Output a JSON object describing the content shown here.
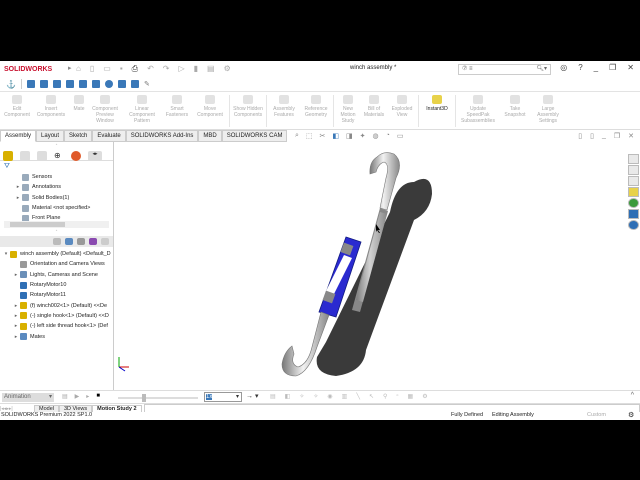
{
  "app": {
    "logo": "SOLIDWORKS",
    "title": "winch assembly *",
    "search_placeholder": "",
    "search_prefix": "⑦ ≡"
  },
  "command_manager": [
    {
      "label": "Edit Component",
      "active": false
    },
    {
      "label": "Insert Components",
      "active": false
    },
    {
      "label": "Mate",
      "active": false
    },
    {
      "label": "Component Preview Window",
      "active": false
    },
    {
      "label": "Linear Component Pattern",
      "active": false
    },
    {
      "label": "Smart Fasteners",
      "active": false
    },
    {
      "label": "Move Component",
      "active": false
    },
    {
      "label": "Show Hidden Components",
      "active": false
    },
    {
      "label": "Assembly Features",
      "active": false
    },
    {
      "label": "Reference Geometry",
      "active": false
    },
    {
      "label": "New Motion Study",
      "active": false
    },
    {
      "label": "Bill of Materials",
      "active": false
    },
    {
      "label": "Exploded View",
      "active": false
    },
    {
      "label": "Instant3D",
      "active": true
    },
    {
      "label": "Update SpeedPak Subassemblies",
      "active": false
    },
    {
      "label": "Take Snapshot",
      "active": false
    },
    {
      "label": "Large Assembly Settings",
      "active": false
    }
  ],
  "tabs": [
    "Assembly",
    "Layout",
    "Sketch",
    "Evaluate",
    "SOLIDWORKS Add-Ins",
    "MBD",
    "SOLIDWORKS CAM"
  ],
  "feature_tree_top": [
    "Sensors",
    "Annotations",
    "Solid Bodies(1)",
    "Material <not specified>",
    "Front Plane"
  ],
  "feature_tree": [
    {
      "label": "winch assembly (Default) <Default_D",
      "arrow": "▾",
      "color": "#d8b000"
    },
    {
      "label": "Orientation and Camera Views",
      "arrow": "",
      "color": "#999"
    },
    {
      "label": "Lights, Cameras and Scene",
      "arrow": "▸",
      "color": "#6a8fb8"
    },
    {
      "label": "RotaryMotor10",
      "arrow": "",
      "color": "#2f6fb5"
    },
    {
      "label": "RotaryMotor11",
      "arrow": "",
      "color": "#2f6fb5"
    },
    {
      "label": "(f) winch002<1> (Default) <<De",
      "arrow": "▸",
      "color": "#d8b000"
    },
    {
      "label": "(-) single hook<1> (Default) <<D",
      "arrow": "▸",
      "color": "#d8b000"
    },
    {
      "label": "(-) left side thread hook<1> (Def",
      "arrow": "▸",
      "color": "#d8b000"
    },
    {
      "label": "Mates",
      "arrow": "▸",
      "color": "#5a8ac0"
    }
  ],
  "motion": {
    "study_type": "Animation",
    "speed": "1x",
    "tabs": [
      "Model",
      "3D Views",
      "Motion Study 2"
    ],
    "active_tab": "Motion Study 2"
  },
  "status": {
    "product": "SOLIDWORKS Premium 2022 SP1.0",
    "state": "Fully Defined",
    "mode": "Editing Assembly",
    "units": "Custom"
  },
  "colors": {
    "accent": "#c8102e",
    "model_blue": "#2a2ad0"
  }
}
